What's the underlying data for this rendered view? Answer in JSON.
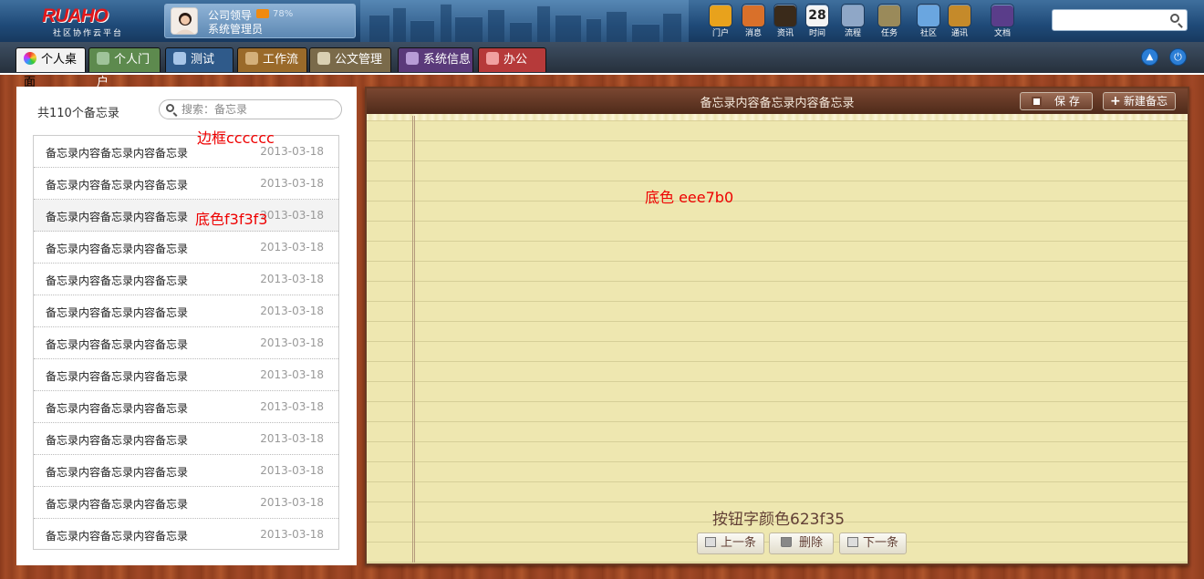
{
  "logo": {
    "brand": "RUAHO",
    "subtitle": "社区协作云平台"
  },
  "user": {
    "name": "公司领导",
    "role": "系统管理员",
    "percent": "78%"
  },
  "apps": [
    {
      "label": "门户",
      "icon": "portal-icon",
      "color": "#e8a21c"
    },
    {
      "label": "消息",
      "icon": "message-icon",
      "color": "#d9702a"
    },
    {
      "label": "资讯",
      "icon": "news-icon",
      "color": "#3a2a1a"
    },
    {
      "label": "时间",
      "icon": "calendar-icon",
      "color": "#f4f4f4",
      "text": "28"
    },
    {
      "label": "流程",
      "icon": "workflow-icon",
      "color": "#8fa7c7"
    },
    {
      "label": "任务",
      "icon": "task-icon",
      "color": "#9a8a5a"
    },
    {
      "label": "社区",
      "icon": "community-icon",
      "color": "#6aa6e0"
    },
    {
      "label": "通讯",
      "icon": "contacts-icon",
      "color": "#c58a2a"
    },
    {
      "label": "文档",
      "icon": "document-icon",
      "color": "#5a3d8a"
    }
  ],
  "nav": {
    "tabs": [
      {
        "label": "个人桌面",
        "icon": "desktop-icon",
        "bg": "#f2f2f2",
        "fg": "#000"
      },
      {
        "label": "个人门户",
        "icon": "portal-icon",
        "bg": "#5d8a4e",
        "fg": "#fff"
      },
      {
        "label": "测试",
        "icon": "monitor-icon",
        "bg": "#2f5a8a",
        "fg": "#fff"
      },
      {
        "label": "工作流",
        "icon": "workflow-icon",
        "bg": "#9a6a2a",
        "fg": "#fff"
      },
      {
        "label": "公文管理",
        "icon": "official-document-icon",
        "bg": "#7a6a4a",
        "fg": "#fff"
      },
      {
        "label": "系统信息",
        "icon": "settings-icon",
        "bg": "#5a3a7a",
        "fg": "#fff"
      },
      {
        "label": "办公",
        "icon": "briefcase-icon",
        "bg": "#b63a3a",
        "fg": "#fff"
      }
    ]
  },
  "memo_list": {
    "count_label": "共110个备忘录",
    "search_placeholder": "搜索：备忘录",
    "items": [
      {
        "title": "备忘录内容备忘录内容备忘录",
        "date": "2013-03-18"
      },
      {
        "title": "备忘录内容备忘录内容备忘录",
        "date": "2013-03-18"
      },
      {
        "title": "备忘录内容备忘录内容备忘录",
        "date": "2013-03-18"
      },
      {
        "title": "备忘录内容备忘录内容备忘录",
        "date": "2013-03-18"
      },
      {
        "title": "备忘录内容备忘录内容备忘录",
        "date": "2013-03-18"
      },
      {
        "title": "备忘录内容备忘录内容备忘录",
        "date": "2013-03-18"
      },
      {
        "title": "备忘录内容备忘录内容备忘录",
        "date": "2013-03-18"
      },
      {
        "title": "备忘录内容备忘录内容备忘录",
        "date": "2013-03-18"
      },
      {
        "title": "备忘录内容备忘录内容备忘录",
        "date": "2013-03-18"
      },
      {
        "title": "备忘录内容备忘录内容备忘录",
        "date": "2013-03-18"
      },
      {
        "title": "备忘录内容备忘录内容备忘录",
        "date": "2013-03-18"
      },
      {
        "title": "备忘录内容备忘录内容备忘录",
        "date": "2013-03-18"
      },
      {
        "title": "备忘录内容备忘录内容备忘录",
        "date": "2013-03-18"
      }
    ]
  },
  "memo": {
    "title": "备忘录内容备忘录内容备忘录",
    "save_label": "保 存",
    "new_label": "新建备忘"
  },
  "footer": {
    "prev_label": "上一条",
    "delete_label": "删除",
    "next_label": "下一条"
  },
  "annotations": {
    "border": "边框cccccc",
    "row_bg": "底色f3f3f3",
    "paper_bg": "底色 eee7b0",
    "btn_color": "按钮字颜色623f35"
  },
  "colors": {
    "list_border": "#cccccc",
    "row_selected": "#f3f3f3",
    "paper": "#eee7b0",
    "button_text": "#623f35"
  }
}
